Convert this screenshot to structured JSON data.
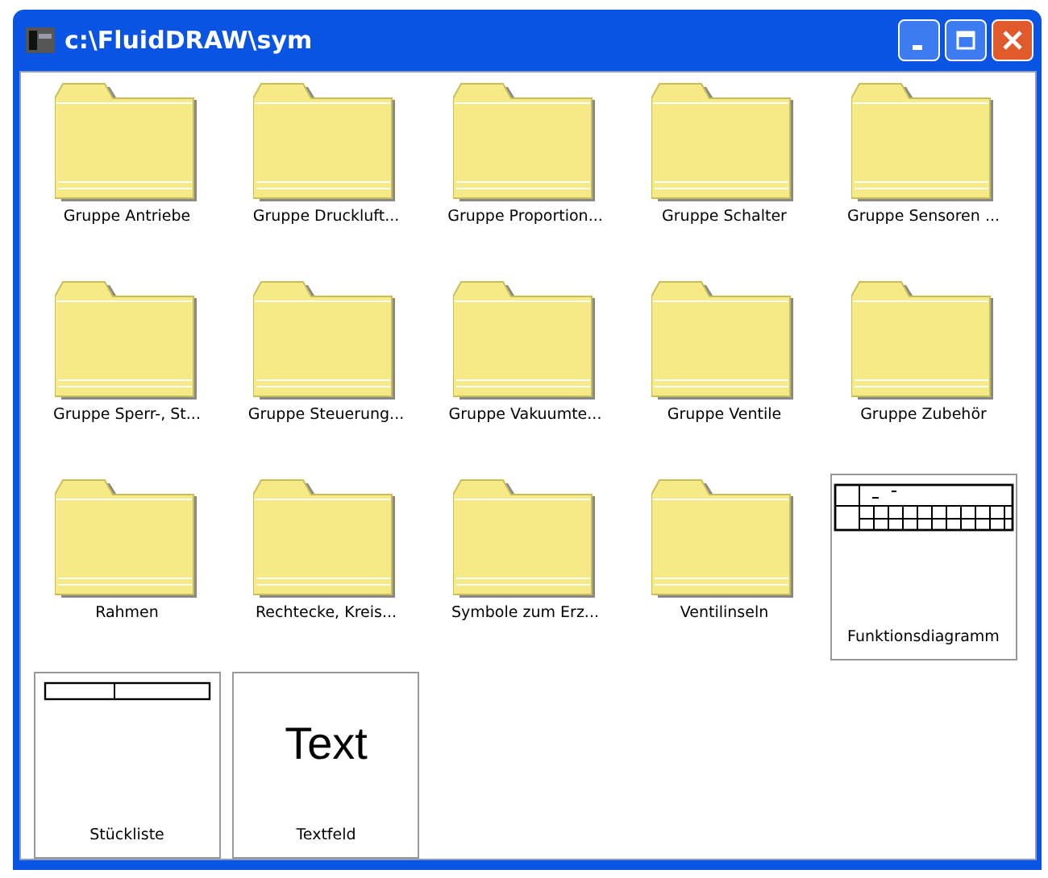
{
  "window": {
    "title": "c:\\FluidDRAW\\sym"
  },
  "items": [
    {
      "kind": "folder",
      "label": "Gruppe Antriebe"
    },
    {
      "kind": "folder",
      "label": "Gruppe Druckluft..."
    },
    {
      "kind": "folder",
      "label": "Gruppe Proportion..."
    },
    {
      "kind": "folder",
      "label": "Gruppe Schalter"
    },
    {
      "kind": "folder",
      "label": "Gruppe Sensoren ..."
    },
    {
      "kind": "folder",
      "label": "Gruppe Sperr-, St..."
    },
    {
      "kind": "folder",
      "label": "Gruppe Steuerung..."
    },
    {
      "kind": "folder",
      "label": "Gruppe Vakuumte..."
    },
    {
      "kind": "folder",
      "label": "Gruppe Ventile"
    },
    {
      "kind": "folder",
      "label": "Gruppe Zubehör"
    },
    {
      "kind": "folder",
      "label": "Rahmen"
    },
    {
      "kind": "folder",
      "label": "Rechtecke, Kreis..."
    },
    {
      "kind": "folder",
      "label": "Symbole zum Erz..."
    },
    {
      "kind": "folder",
      "label": "Ventilinseln"
    },
    {
      "kind": "diagram",
      "label": "Funktionsdiagramm"
    },
    {
      "kind": "partslist",
      "label": "Stückliste"
    },
    {
      "kind": "text",
      "label": "Textfeld",
      "preview": "Text"
    }
  ]
}
